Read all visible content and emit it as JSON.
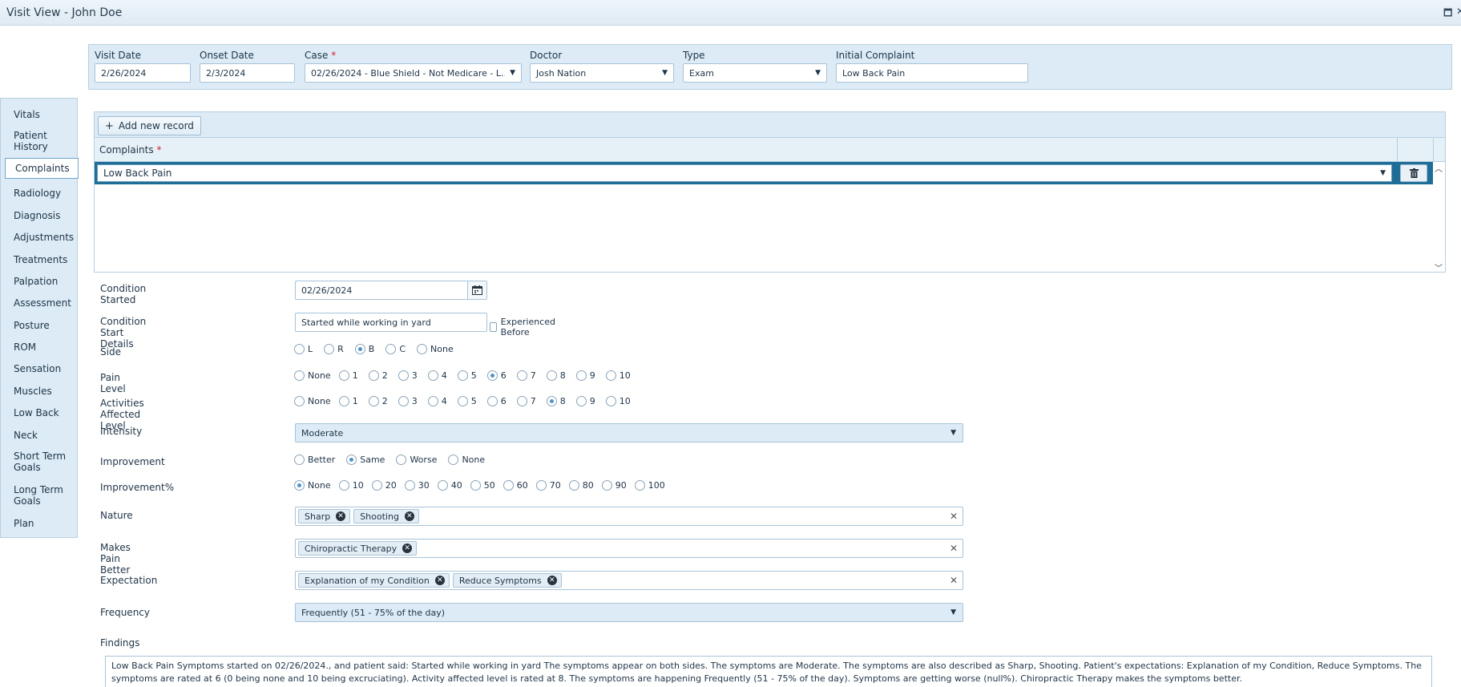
{
  "window": {
    "title": "Visit View - John Doe",
    "restore_glyph": "🗖",
    "close_glyph": "✕"
  },
  "header": {
    "visit_date": {
      "label": "Visit Date",
      "value": "2/26/2024"
    },
    "onset_date": {
      "label": "Onset Date",
      "value": "2/3/2024"
    },
    "case": {
      "label": "Case",
      "required": "*",
      "value": "02/26/2024 - Blue Shield - Not Medicare - L..."
    },
    "doctor": {
      "label": "Doctor",
      "value": "Josh Nation"
    },
    "type": {
      "label": "Type",
      "value": "Exam"
    },
    "initial_complaint": {
      "label": "Initial Complaint",
      "value": "Low Back Pain"
    }
  },
  "sidebar": {
    "items": [
      {
        "label": "Vitals"
      },
      {
        "label": "Patient History"
      },
      {
        "label": "Complaints",
        "active": true
      },
      {
        "label": "Radiology"
      },
      {
        "label": "Diagnosis"
      },
      {
        "label": "Adjustments"
      },
      {
        "label": "Treatments"
      },
      {
        "label": "Palpation"
      },
      {
        "label": "Assessment"
      },
      {
        "label": "Posture"
      },
      {
        "label": "ROM"
      },
      {
        "label": "Sensation"
      },
      {
        "label": "Muscles"
      },
      {
        "label": "Low Back"
      },
      {
        "label": "Neck"
      },
      {
        "label": "Short Term Goals"
      },
      {
        "label": "Long Term Goals"
      },
      {
        "label": "Plan"
      }
    ]
  },
  "grid": {
    "add_button": "Add new record",
    "column_header": "Complaints",
    "required": "*",
    "rows": [
      {
        "complaint": "Low Back Pain"
      }
    ]
  },
  "form": {
    "condition_started": {
      "label": "Condition Started",
      "value": "02/26/2024"
    },
    "condition_start_details": {
      "label": "Condition Start Details",
      "value": "Started while working in yard",
      "checkbox_label": "Experienced Before",
      "checked": false
    },
    "side": {
      "label": "Side",
      "options": [
        "L",
        "R",
        "B",
        "C",
        "None"
      ],
      "selected": "B"
    },
    "pain_level": {
      "label": "Pain Level",
      "options": [
        "None",
        "1",
        "2",
        "3",
        "4",
        "5",
        "6",
        "7",
        "8",
        "9",
        "10"
      ],
      "selected": "6"
    },
    "activities_affected": {
      "label": "Activities Affected Level",
      "options": [
        "None",
        "1",
        "2",
        "3",
        "4",
        "5",
        "6",
        "7",
        "8",
        "9",
        "10"
      ],
      "selected": "8"
    },
    "intensity": {
      "label": "Intensity",
      "value": "Moderate"
    },
    "improvement": {
      "label": "Improvement",
      "options": [
        "Better",
        "Same",
        "Worse",
        "None"
      ],
      "selected": "Same"
    },
    "improvement_pct": {
      "label": "Improvement%",
      "options": [
        "None",
        "10",
        "20",
        "30",
        "40",
        "50",
        "60",
        "70",
        "80",
        "90",
        "100"
      ],
      "selected": "None"
    },
    "nature": {
      "label": "Nature",
      "tags": [
        "Sharp",
        "Shooting"
      ]
    },
    "makes_pain_better": {
      "label": "Makes Pain Better",
      "tags": [
        "Chiropractic Therapy"
      ]
    },
    "expectation": {
      "label": "Expectation",
      "tags": [
        "Explanation of my Condition",
        "Reduce Symptoms"
      ]
    },
    "frequency": {
      "label": "Frequency",
      "value": "Frequently (51 - 75% of the day)"
    },
    "findings": {
      "label": "Findings",
      "text": "Low Back Pain Symptoms started on 02/26/2024., and patient said: Started while working in yard The symptoms appear on both sides. The symptoms are Moderate. The symptoms are also described as  Sharp,  Shooting. Patient's expectations:  Explanation of my Condition,  Reduce Symptoms. The symptoms are rated at 6 (0 being none and 10 being excruciating). Activity affected level is rated at 8. The symptoms are happening Frequently (51 - 75% of the day). Symptoms are getting worse (null%).  Chiropractic Therapy makes the symptoms better."
    }
  },
  "colors": {
    "panel": "#dcebf5",
    "border": "#b7cfe2",
    "selected_row": "#1d6d96",
    "required": "#d9232e",
    "radio_on": "#4c93c6"
  }
}
